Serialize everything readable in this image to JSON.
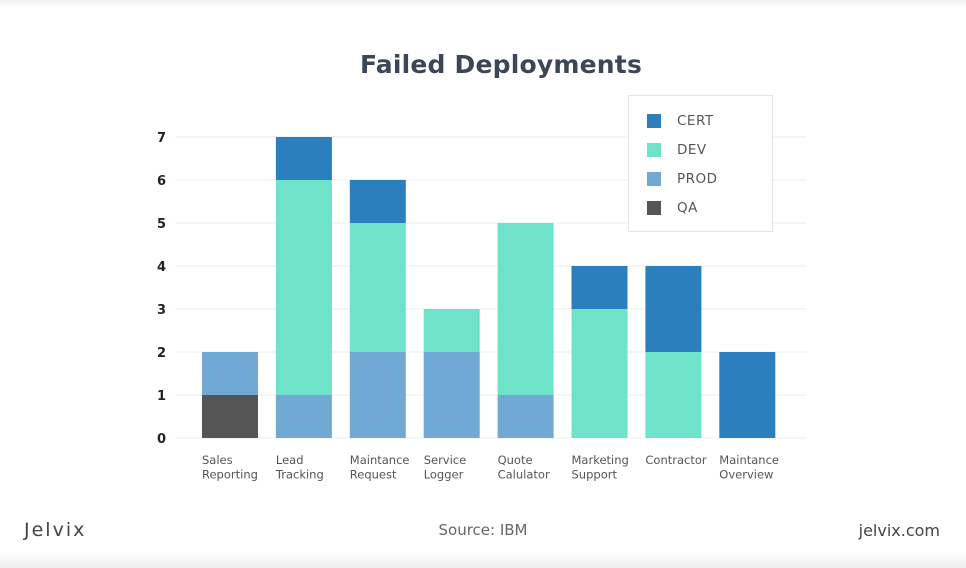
{
  "chart_data": {
    "type": "bar",
    "stacked": true,
    "title": "Failed Deployments",
    "xlabel": "",
    "ylabel": "",
    "ylim": [
      0,
      7
    ],
    "yticks": [
      0,
      1,
      2,
      3,
      4,
      5,
      6,
      7
    ],
    "grid": true,
    "legend_position": "top-right",
    "categories": [
      [
        "Sales",
        "Reporting"
      ],
      [
        "Lead",
        "Tracking"
      ],
      [
        "Maintance",
        "Request"
      ],
      [
        "Service",
        "Logger"
      ],
      [
        "Quote",
        "Calulator"
      ],
      [
        "Marketing",
        "Support"
      ],
      [
        "Contractor"
      ],
      [
        "Maintance",
        "Overview"
      ]
    ],
    "series": [
      {
        "name": "QA",
        "color": "#555555",
        "values": [
          1,
          0,
          0,
          0,
          0,
          0,
          0,
          0
        ]
      },
      {
        "name": "PROD",
        "color": "#70a9d3",
        "values": [
          1,
          1,
          2,
          2,
          1,
          0,
          0,
          0
        ]
      },
      {
        "name": "DEV",
        "color": "#6fe3c9",
        "values": [
          0,
          5,
          3,
          1,
          4,
          3,
          2,
          0
        ]
      },
      {
        "name": "CERT",
        "color": "#2b7fbd",
        "values": [
          0,
          1,
          1,
          0,
          0,
          1,
          2,
          2
        ]
      }
    ],
    "legend_order": [
      "CERT",
      "DEV",
      "PROD",
      "QA"
    ]
  },
  "legend": [
    {
      "label": "CERT",
      "color": "#2b7fbd"
    },
    {
      "label": "DEV",
      "color": "#6fe3c9"
    },
    {
      "label": "PROD",
      "color": "#70a9d3"
    },
    {
      "label": "QA",
      "color": "#555555"
    }
  ],
  "footer": {
    "brand": "Jelvix",
    "source": "Source: IBM",
    "site": "jelvix.com"
  }
}
